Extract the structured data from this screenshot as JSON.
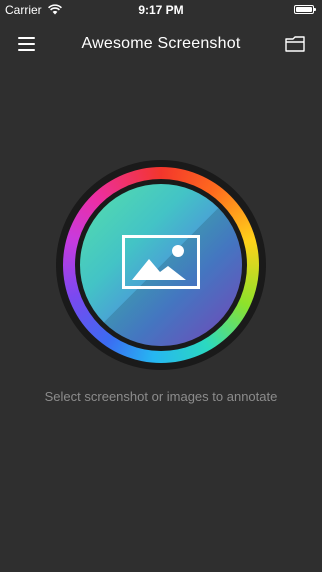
{
  "status_bar": {
    "carrier": "Carrier",
    "time": "9:17 PM",
    "wifi_icon": "wifi-icon",
    "battery_icon": "battery-icon"
  },
  "nav": {
    "title": "Awesome Screenshot",
    "menu_icon": "hamburger-menu-icon",
    "folder_icon": "folder-icon"
  },
  "main": {
    "picker_icon": "image-icon",
    "hint": "Select screenshot or images to annotate"
  },
  "colors": {
    "background": "#2f2f2f",
    "title_text": "#ffffff",
    "hint_text": "#8c8c8c",
    "ring_dark": "#1a1a1a"
  }
}
